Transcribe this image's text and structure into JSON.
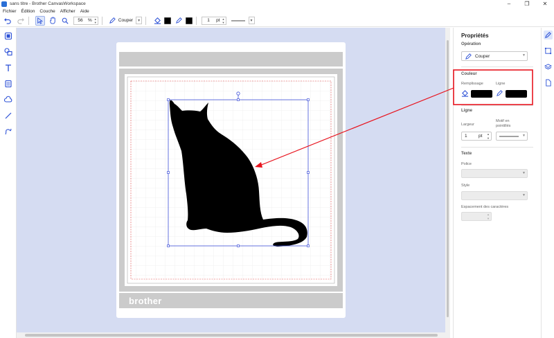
{
  "window": {
    "title": "sans titre - Brother CanvasWorkspace"
  },
  "menu": [
    "Fichier",
    "Édition",
    "Couche",
    "Afficher",
    "Aide"
  ],
  "toolbar": {
    "zoom_value": "56",
    "zoom_unit": "%",
    "operation_label": "Couper",
    "fill_color": "#000000",
    "line_color": "#000000",
    "line_width_value": "1",
    "line_width_unit": "pt"
  },
  "properties": {
    "title": "Propriétés",
    "operation": {
      "section_label": "Opération",
      "value": "Couper"
    },
    "color": {
      "section_label": "Couleur",
      "fill_label": "Remplissage",
      "line_label": "Ligne",
      "fill_color": "#000000",
      "line_color": "#000000"
    },
    "line": {
      "section_label": "Ligne",
      "width_label": "Largeur",
      "width_value": "1",
      "width_unit": "pt",
      "dash_label": "Motif en pointillés"
    },
    "text": {
      "section_label": "Texte",
      "font_label": "Police",
      "style_label": "Style",
      "spacing_label": "Espacement des caractères"
    }
  },
  "mat": {
    "brand_label": "brother"
  },
  "colors": {
    "canvas_bg": "#d5dcf2",
    "accent": "#2a4fd6",
    "highlight": "#e8141e",
    "mat_grey": "#cbcbcb"
  }
}
